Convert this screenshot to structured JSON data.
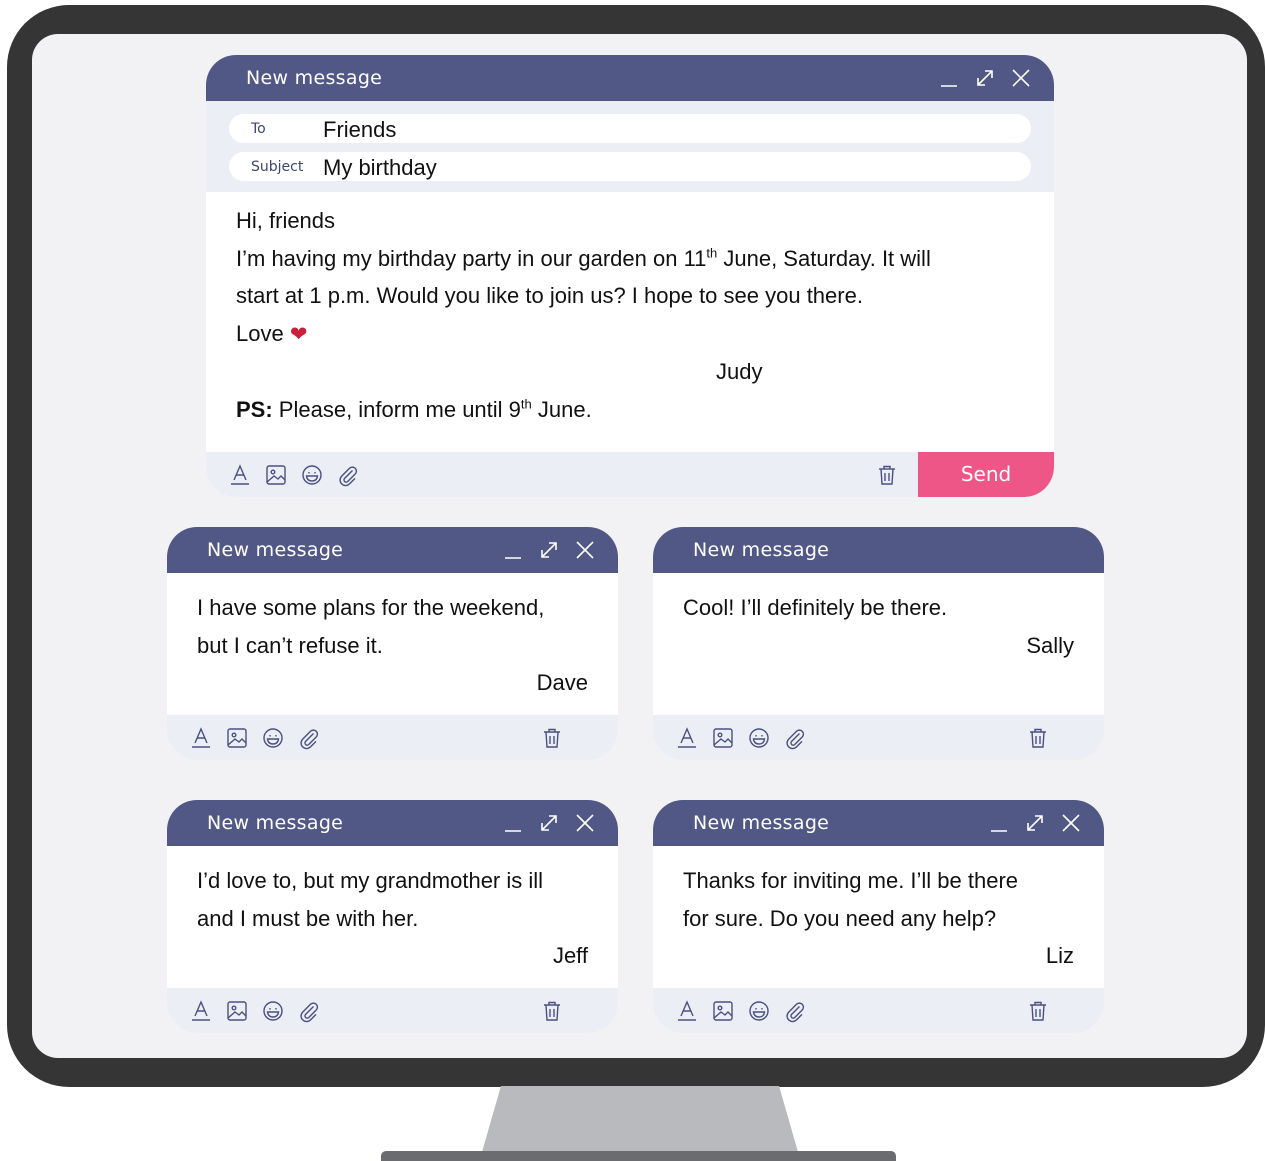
{
  "main_window": {
    "title": "New message",
    "to_label": "To",
    "to_value": "Friends",
    "subject_label": "Subject",
    "subject_value": "My birthday",
    "greeting": "Hi, friends",
    "line1_before": "I’m having my birthday party in our garden on 11",
    "line1_sup": "th",
    "line1_after": " June, Saturday. It will",
    "line2": "start at 1 p.m. Would you like to join us? I hope to see you there.",
    "closing": "Love",
    "heart_icon": "heart-icon",
    "signature": "Judy",
    "ps_label": "PS:",
    "ps_before": " Please, inform me until 9",
    "ps_sup": "th",
    "ps_after": " June.",
    "send_label": "Send"
  },
  "replies": [
    {
      "title": "New message",
      "lines": [
        "I have some plans for the weekend,",
        "but I can’t refuse it."
      ],
      "signature": "Dave"
    },
    {
      "title": "New message",
      "lines": [
        "Cool! I’ll definitely be there."
      ],
      "signature": "Sally"
    },
    {
      "title": "New message",
      "lines": [
        "I’d love to, but my grandmother is ill",
        "and I must be with her."
      ],
      "signature": "Jeff"
    },
    {
      "title": "New message",
      "lines": [
        "Thanks for inviting me. I’ll be there",
        "for sure. Do you need any help?"
      ],
      "signature": "Liz"
    }
  ],
  "icons": {
    "window_controls": [
      "minimize-icon",
      "expand-icon",
      "close-icon"
    ],
    "toolbar": [
      "text-format-icon",
      "image-icon",
      "emoji-icon",
      "attachment-icon"
    ],
    "delete": "trash-icon"
  },
  "colors": {
    "header": "#525886",
    "send": "#ef5688",
    "toolbar": "#eceef5",
    "heart": "#c8203a",
    "monitor_frame": "#353535",
    "screen": "#f2f2f4"
  }
}
